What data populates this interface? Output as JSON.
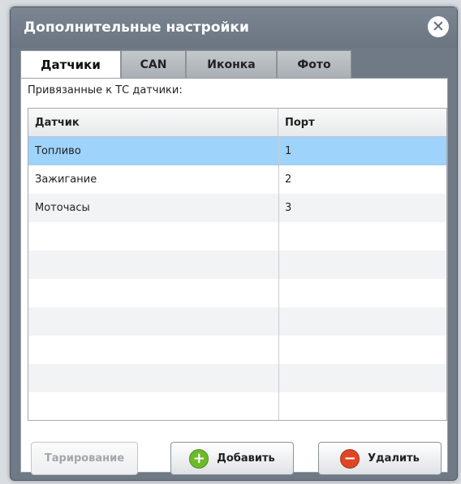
{
  "dialog": {
    "title": "Дополнительные настройки",
    "close_icon": "close-x-icon"
  },
  "tabs": [
    {
      "label": "Датчики",
      "active": true
    },
    {
      "label": "CAN",
      "active": false
    },
    {
      "label": "Иконка",
      "active": false
    },
    {
      "label": "Фото",
      "active": false
    }
  ],
  "sensors": {
    "caption": "Привязанные к ТС датчики:",
    "columns": [
      "Датчик",
      "Порт"
    ],
    "rows": [
      {
        "sensor": "Топливо",
        "port": "1",
        "selected": true
      },
      {
        "sensor": "Зажигание",
        "port": "2",
        "selected": false
      },
      {
        "sensor": "Моточасы",
        "port": "3",
        "selected": false
      }
    ],
    "selected_color": "#9ed3fb"
  },
  "buttons": {
    "calibrate_label": "Тарирование",
    "add_label": "Добавить",
    "delete_label": "Удалить",
    "add_icon": "plus-circle-icon",
    "delete_icon": "minus-circle-icon"
  }
}
